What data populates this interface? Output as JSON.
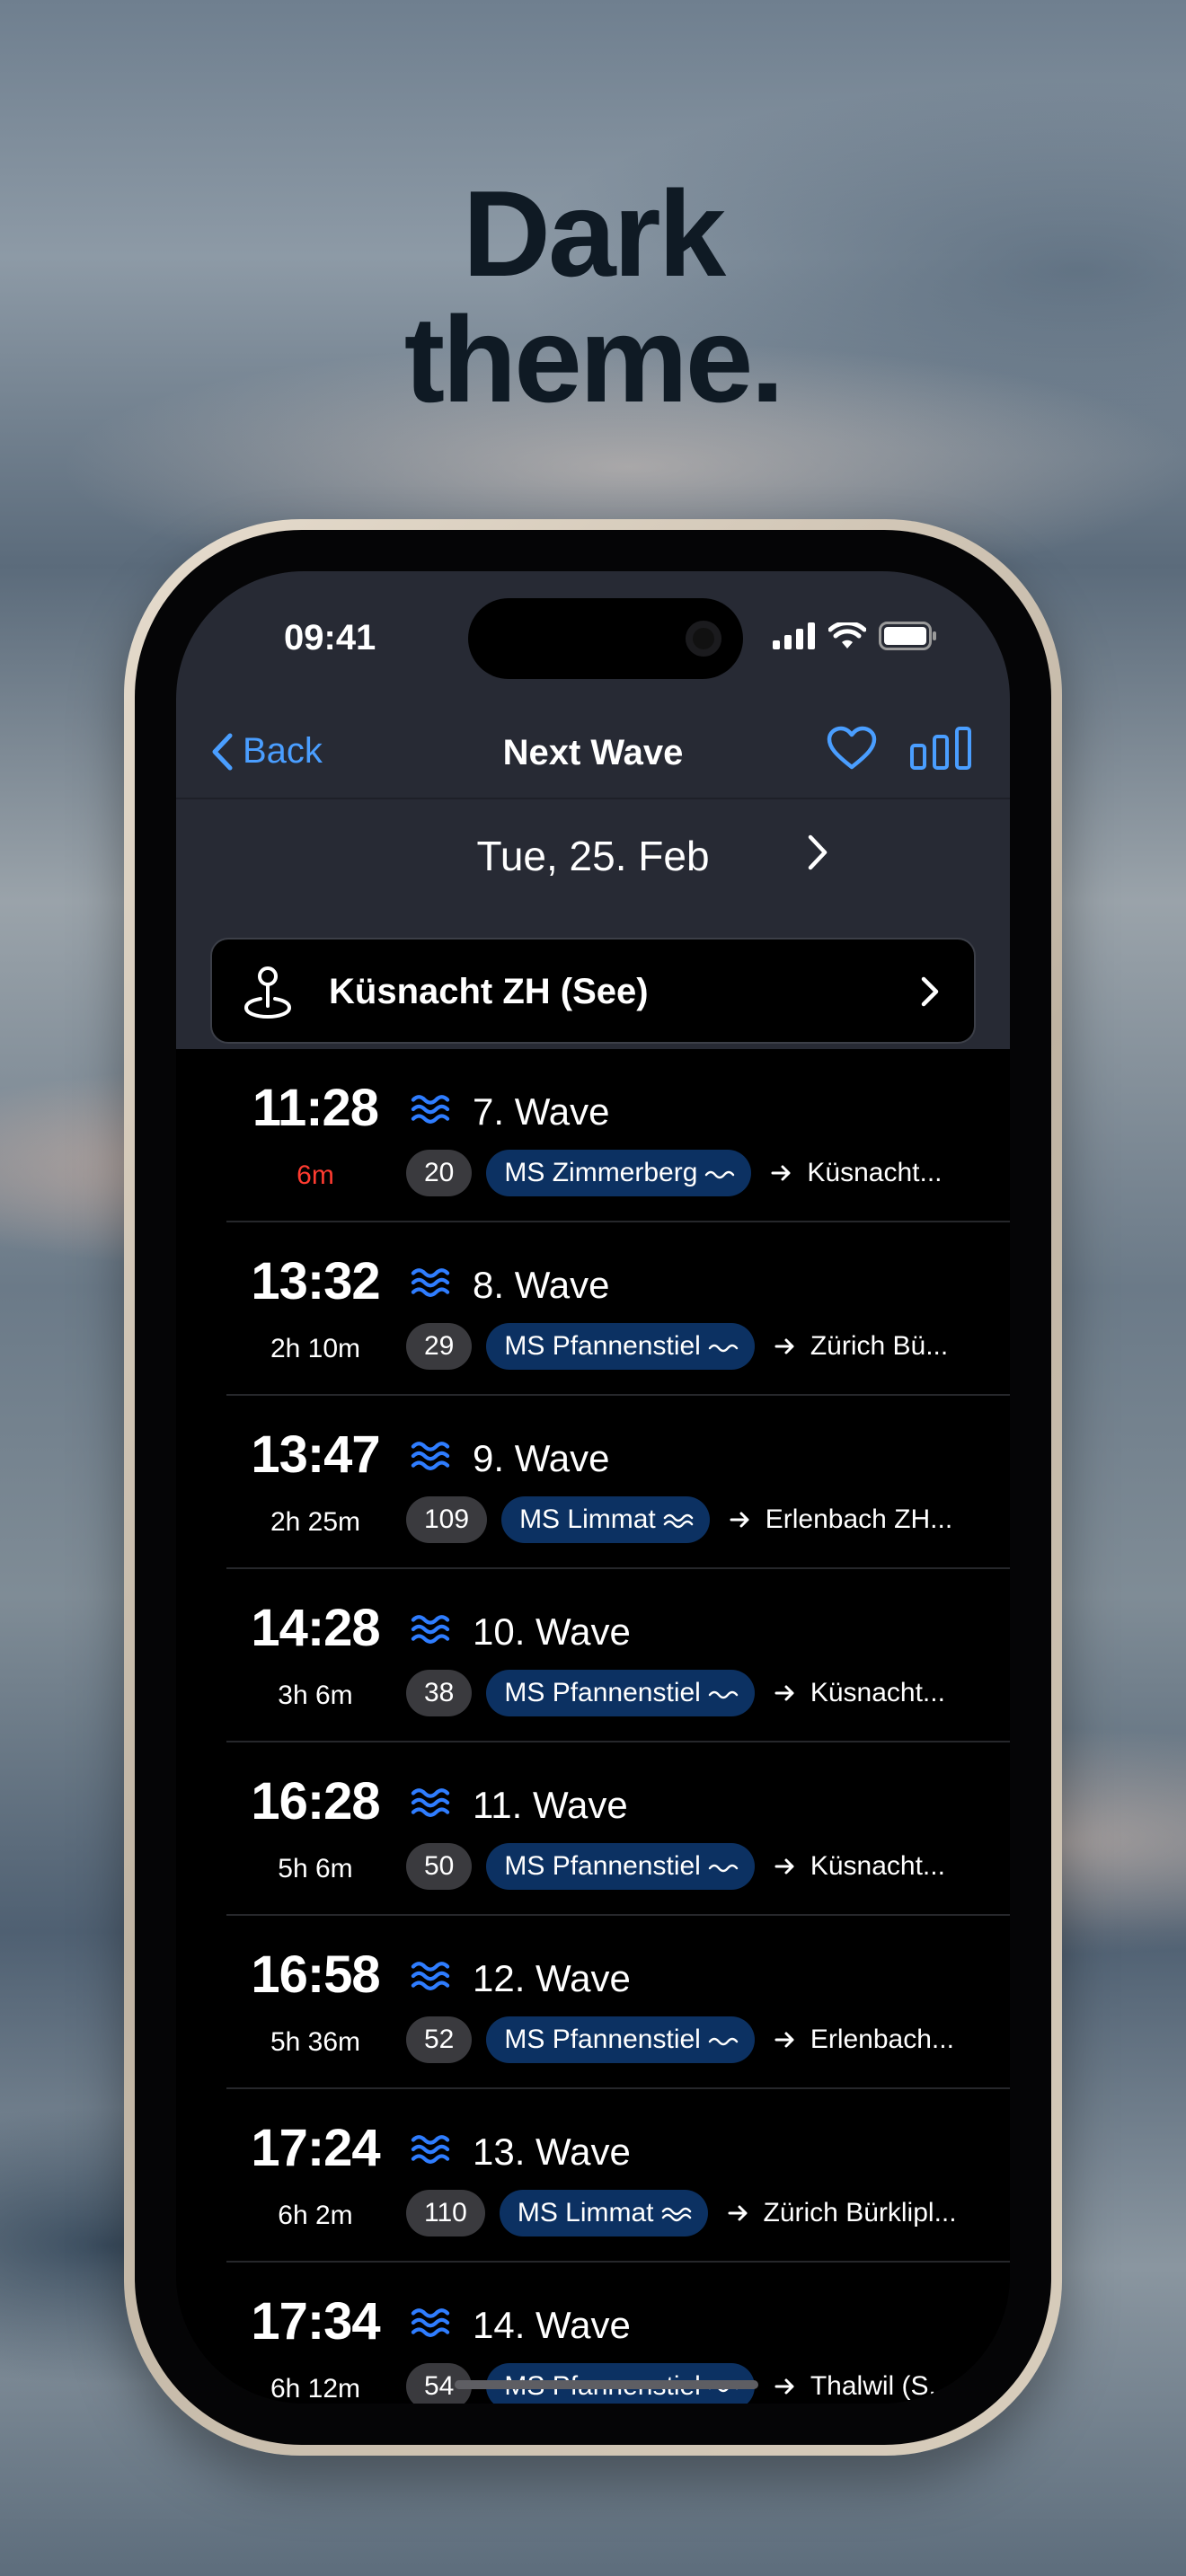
{
  "headline": {
    "line1": "Dark",
    "line2": "theme."
  },
  "status": {
    "time": "09:41"
  },
  "nav": {
    "back_label": "Back",
    "title": "Next Wave"
  },
  "date": {
    "label": "Tue, 25. Feb"
  },
  "location": {
    "name": "Küsnacht ZH (See)"
  },
  "departures": [
    {
      "time": "11:28",
      "delay": "6m",
      "urgent": true,
      "wave": "7. Wave",
      "number": "20",
      "ship": "MS Zimmerberg",
      "destination": "Küsnacht..."
    },
    {
      "time": "13:32",
      "delay": "2h 10m",
      "urgent": false,
      "wave": "8. Wave",
      "number": "29",
      "ship": "MS Pfannenstiel",
      "destination": "Zürich Bü..."
    },
    {
      "time": "13:47",
      "delay": "2h 25m",
      "urgent": false,
      "wave": "9. Wave",
      "number": "109",
      "ship": "MS Limmat",
      "destination": "Erlenbach ZH..."
    },
    {
      "time": "14:28",
      "delay": "3h 6m",
      "urgent": false,
      "wave": "10. Wave",
      "number": "38",
      "ship": "MS Pfannenstiel",
      "destination": "Küsnacht..."
    },
    {
      "time": "16:28",
      "delay": "5h 6m",
      "urgent": false,
      "wave": "11. Wave",
      "number": "50",
      "ship": "MS Pfannenstiel",
      "destination": "Küsnacht..."
    },
    {
      "time": "16:58",
      "delay": "5h 36m",
      "urgent": false,
      "wave": "12. Wave",
      "number": "52",
      "ship": "MS Pfannenstiel",
      "destination": "Erlenbach..."
    },
    {
      "time": "17:24",
      "delay": "6h 2m",
      "urgent": false,
      "wave": "13. Wave",
      "number": "110",
      "ship": "MS Limmat",
      "destination": "Zürich Bürklipl..."
    },
    {
      "time": "17:34",
      "delay": "6h 12m",
      "urgent": false,
      "wave": "14. Wave",
      "number": "54",
      "ship": "MS Pfannenstiel",
      "destination": "Thalwil (S..."
    }
  ],
  "colors": {
    "accent": "#4a9eff",
    "urgent": "#ff3b30",
    "ship_pill": "#0c3162",
    "header_bg": "#272a34"
  }
}
